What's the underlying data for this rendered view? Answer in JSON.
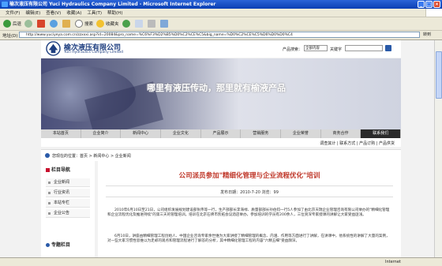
{
  "window": {
    "title": "榆次液压有限公司 Yuci Hydraulics Company Limited - Microsoft Internet Explorer"
  },
  "menu": [
    "文件(F)",
    "编辑(E)",
    "查看(V)",
    "收藏(A)",
    "工具(T)",
    "帮助(H)"
  ],
  "toolbar": {
    "back": "后退",
    "search": "搜索",
    "favorites": "收藏夹"
  },
  "address": {
    "label": "地址(D)",
    "url": "http://www.yuciyeya.com.cn/zzxxxi.asp?id=20084&pro_name=%C6%F3%D2%B5%D0%C2%CE%C5&big_name=%D0%C2%CE%C5%D6%D0%D0%C4",
    "go": "转到"
  },
  "site": {
    "name_cn": "榆次液压有限公司",
    "name_en": "Yuci Hydraulics Company Limited",
    "search_label": "产品搜索：",
    "search_scope": "全部内容",
    "keyword_label": "关键字",
    "slogan": "哪里有液压传动，那里就有榆液产品"
  },
  "nav": [
    "本站首页",
    "企业简介",
    "新闻中心",
    "企业文化",
    "产品展示",
    "营销服务",
    "企业荣誉",
    "商务合作",
    "联系我们"
  ],
  "nav_active_index": 8,
  "subnav": "调查其计 | 联系方式 | 产品订购 | 产品供货",
  "breadcrumb": "您现在的位置：首页 > 新闻中心 > 企业新闻",
  "sidebar": {
    "heading": "栏目导航",
    "items": [
      "企业新闻",
      "行业资讯",
      "本站专栏",
      "企业公告"
    ],
    "heading2": "专题栏目"
  },
  "article": {
    "title": "公司派员参加\"精细化管理与企业流程优化\"培训",
    "meta": "发布日期：2010-7-20    浏览：99",
    "para1": "2010年6月10日至21日，公司组织发展规划建设部张伟等一行，生产部部长李海禄、质量部部长孙伯钧一行5人参加了由北京天瑞企业管理咨询有限公司举办的\"精细化管理和企业流程优化及推进持续\"的第三天的管理培训。培训在北京石佛市凯拓会议酒店举办，参加培训的学员有200余人，三位资深专家授课的讲解让大家受益匪浅。",
    "para2": "6月10日，讲座由精细管理工程创始人、中国企业咨询专家余世维为大家讲授了精细管理的概念、内涵、作用等方面进行了讲解，在讲课中，他系统性的讲解了大量的案例，对一些大家习惯性思维以为走却的观点和管理流程进行了解答的分析，其中精细化管理工程的内容\"六精五细\"受益颇深。"
  },
  "status": {
    "text": "",
    "zone": "Internet"
  }
}
